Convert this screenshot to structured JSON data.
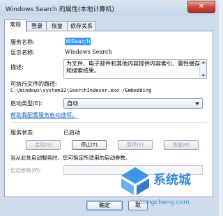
{
  "window": {
    "title": "Windows Search 的属性(本地计算机)",
    "close": "✕"
  },
  "tabs": [
    "常规",
    "登录",
    "恢复",
    "依存关系"
  ],
  "general": {
    "service_name_label": "服务名称:",
    "service_name": "WSearch",
    "display_name_label": "显示名称:",
    "display_name": "Windows Search",
    "description_label": "描述:",
    "description": "为文件、电子邮件和其他内容提供内容索引、属性缓存和搜索结果。",
    "path_label": "可执行文件的路径:",
    "path": "C:\\Windows\\system32\\SearchIndexer.exe /Embedding",
    "startup_type_label": "启动类型(E):",
    "startup_type": "自动",
    "help_link": "帮助我配置服务启动选项。",
    "status_label": "服务状态:",
    "status": "已启动",
    "buttons": {
      "start": "启动(S)",
      "stop": "停止(T)",
      "pause": "暂停(P)",
      "resume": "恢复(R)"
    },
    "hint": "当从此处启动服务时，您可指定所适用的启动参数。",
    "param_label": "启动参数(M):",
    "param_value": ""
  },
  "footer": {
    "ok": "确定",
    "cancel": "取"
  },
  "watermark": {
    "text": "系统城",
    "url": "xitongcheng.com"
  }
}
